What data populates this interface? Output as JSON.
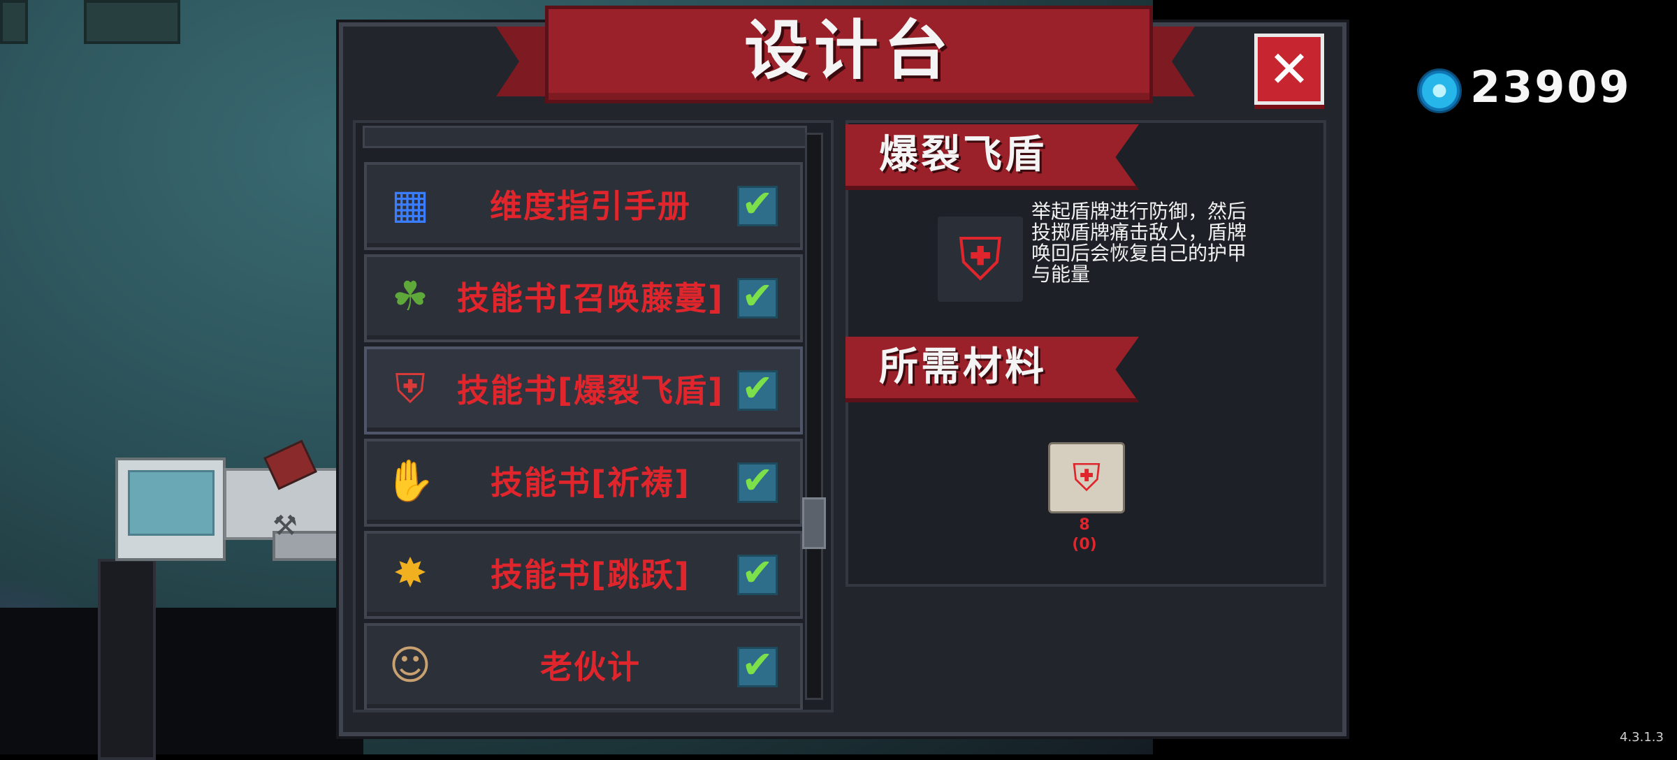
{
  "header": {
    "title": "设计台",
    "close_icon": "close-x-icon"
  },
  "currency": {
    "icon": "blue-gem-icon",
    "amount": "23909"
  },
  "recipe_list": {
    "items": [
      {
        "label": "维度指引手册",
        "icon": "dimension-manual-icon",
        "icon_glyph": "▦",
        "icon_color": "#3b7dff",
        "checked": true
      },
      {
        "label": "技能书[召唤藤蔓]",
        "icon": "vine-summon-icon",
        "icon_glyph": "☘",
        "icon_color": "#5fa83a",
        "checked": true
      },
      {
        "label": "技能书[爆裂飞盾]",
        "icon": "flying-shield-icon",
        "icon_glyph": "⛨",
        "icon_color": "#d83a3a",
        "checked": true
      },
      {
        "label": "技能书[祈祷]",
        "icon": "prayer-hand-icon",
        "icon_glyph": "✋",
        "icon_color": "#f2a23a",
        "checked": true
      },
      {
        "label": "技能书[跳跃]",
        "icon": "jump-burst-icon",
        "icon_glyph": "✸",
        "icon_color": "#f0b020",
        "checked": true
      },
      {
        "label": "老伙计",
        "icon": "old-buddy-character-icon",
        "icon_glyph": "☺",
        "icon_color": "#c9a070",
        "checked": true
      }
    ],
    "check_glyph": "✔"
  },
  "detail": {
    "name": "爆裂飞盾",
    "icon": "flying-shield-icon",
    "icon_glyph": "⛨",
    "description_lines": [
      "举起盾牌进行防御，然后",
      "投掷盾牌痛击敌人，盾牌",
      "唤回后会恢复自己的护甲",
      "与能量"
    ],
    "materials_title": "所需材料",
    "material": {
      "icon": "shield-scroll-icon",
      "glyph": "⛨",
      "required": "8",
      "owned": "(0)"
    }
  },
  "version": "4.3.1.3",
  "colors": {
    "accent_red": "#9a2029",
    "label_red": "#e0262c",
    "check_green": "#7be04a",
    "panel_bg": "#22252c"
  }
}
